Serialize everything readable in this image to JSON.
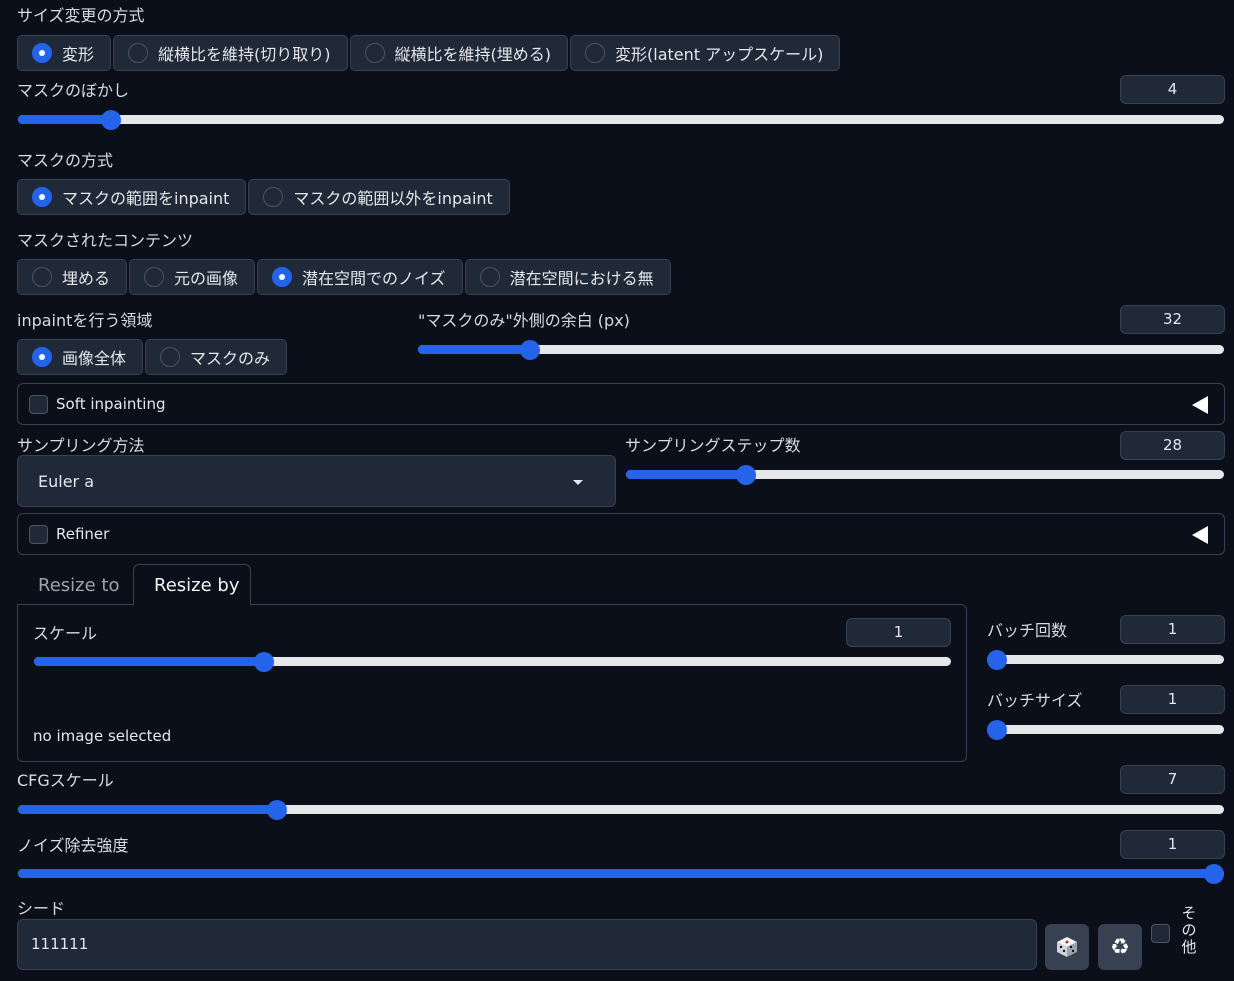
{
  "resize_mode": {
    "label": "サイズ変更の方式",
    "options": [
      "変形",
      "縦横比を維持(切り取り)",
      "縦横比を維持(埋める)",
      "変形(latent アップスケール)"
    ],
    "selected": "変形"
  },
  "mask_blur": {
    "label": "マスクのぼかし",
    "value": "4",
    "fraction": 0.07
  },
  "mask_mode": {
    "label": "マスクの方式",
    "options": [
      "マスクの範囲をinpaint",
      "マスクの範囲以外をinpaint"
    ],
    "selected": "マスクの範囲をinpaint"
  },
  "masked_content": {
    "label": "マスクされたコンテンツ",
    "options": [
      "埋める",
      "元の画像",
      "潜在空間でのノイズ",
      "潜在空間における無"
    ],
    "selected": "潜在空間でのノイズ"
  },
  "inpaint_area": {
    "label": "inpaintを行う領域",
    "options": [
      "画像全体",
      "マスクのみ"
    ],
    "selected": "画像全体"
  },
  "only_masked_padding": {
    "label": "\"マスクのみ\"外側の余白 (px)",
    "value": "32",
    "fraction": 0.13
  },
  "soft_inpainting": {
    "label": "Soft inpainting"
  },
  "sampler": {
    "label": "サンプリング方法",
    "value": "Euler a"
  },
  "steps": {
    "label": "サンプリングステップ数",
    "value": "28",
    "fraction": 0.19
  },
  "refiner": {
    "label": "Refiner"
  },
  "resize_tabs": {
    "tabs": [
      "Resize to",
      "Resize by"
    ],
    "active": "Resize by"
  },
  "scale": {
    "label": "スケール",
    "value": "1",
    "fraction": 0.245
  },
  "no_image": "no image selected",
  "batch_count": {
    "label": "バッチ回数",
    "value": "1",
    "fraction": 0.0
  },
  "batch_size": {
    "label": "バッチサイズ",
    "value": "1",
    "fraction": 0.0
  },
  "cfg_scale": {
    "label": "CFGスケール",
    "value": "7",
    "fraction": 0.21
  },
  "denoising": {
    "label": "ノイズ除去強度",
    "value": "1",
    "fraction": 1.0
  },
  "seed": {
    "label": "シード",
    "value": "111111",
    "extra_label": "その他"
  },
  "icons": {
    "dice": "dice-icon",
    "recycle": "recycle-icon"
  }
}
